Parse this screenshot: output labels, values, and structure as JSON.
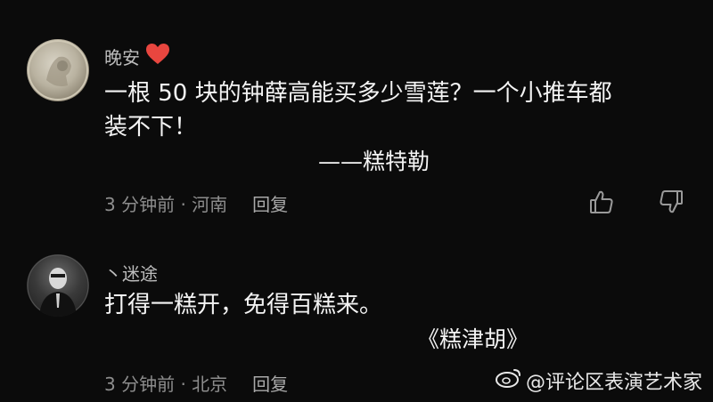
{
  "comments": [
    {
      "username": "晚安",
      "body": "一根 50 块的钟薛高能买多少雪莲？一个小推车都\n装不下！",
      "signature": "——糕特勒",
      "time": "3 分钟前",
      "location": "河南",
      "reply_label": "回复"
    },
    {
      "username": "丶迷途",
      "body": "打得一糕开，免得百糕来。",
      "signature": "《糕津胡》",
      "time": "3 分钟前",
      "location": "北京",
      "reply_label": "回复"
    }
  ],
  "meta_separator": "·",
  "watermark": {
    "text": "@评论区表演艺术家",
    "icon": "weibo-icon"
  },
  "icons": {
    "heart": "heart-icon",
    "like": "thumbs-up-icon",
    "dislike": "thumbs-down-icon"
  },
  "colors": {
    "background": "#0b0b0b",
    "heart": "#e8463f",
    "meta_text": "#8d8d8d"
  }
}
